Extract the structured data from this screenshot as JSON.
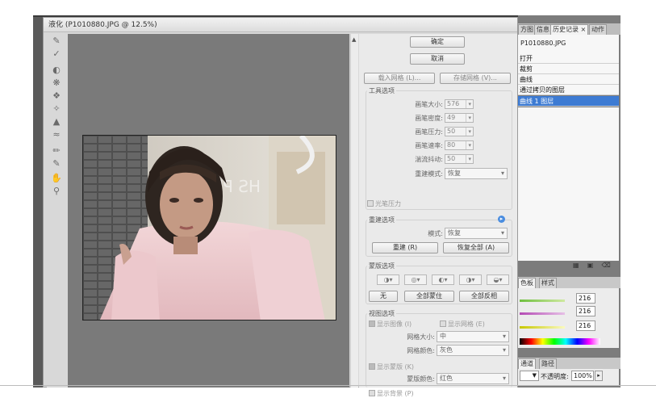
{
  "window": {
    "title": "液化 (P1010880.JPG @ 12.5%)"
  },
  "tools": [
    "forward-warp-icon",
    "reconstruct-icon",
    "twirl-icon",
    "pucker-icon",
    "bloat-icon",
    "push-left-icon",
    "mirror-icon",
    "turbulence-icon",
    "freeze-mask-icon",
    "thaw-mask-icon",
    "hand-icon",
    "zoom-icon"
  ],
  "photo": {
    "sign_text": "HS PLACE"
  },
  "buttons": {
    "ok": "确定",
    "cancel": "取消",
    "load_mesh": "载入网格 (L)...",
    "save_mesh": "存储网格 (V)..."
  },
  "tool_options": {
    "title": "工具选项",
    "brush_size_label": "画笔大小:",
    "brush_size": "576",
    "brush_density_label": "画笔密度:",
    "brush_density": "49",
    "brush_pressure_label": "画笔压力:",
    "brush_pressure": "50",
    "brush_rate_label": "画笔速率:",
    "brush_rate": "80",
    "turbulent_jitter_label": "湍流抖动:",
    "turbulent_jitter": "50",
    "reconstruct_mode_label": "重建模式:",
    "reconstruct_mode": "恢复",
    "stylus_pressure": "光笔压力"
  },
  "reconstruct_options": {
    "title": "重建选项",
    "mode_label": "模式:",
    "mode": "恢复",
    "reconstruct_btn": "重建 (R)",
    "restore_all_btn": "恢复全部 (A)"
  },
  "mask_options": {
    "title": "蒙版选项",
    "none_btn": "无",
    "mask_all_btn": "全部蒙住",
    "invert_all_btn": "全部反相"
  },
  "view_options": {
    "title": "视图选项",
    "show_image": "显示图像 (I)",
    "show_mesh": "显示网格 (E)",
    "mesh_size_label": "网格大小:",
    "mesh_size": "中",
    "mesh_color_label": "网格颜色:",
    "mesh_color": "灰色",
    "show_mask": "显示蒙版 (K)",
    "mask_color_label": "蒙版颜色:",
    "mask_color": "红色",
    "show_backdrop": "显示背景 (P)"
  },
  "right_panel": {
    "tabs": [
      "方图",
      "信息",
      "历史记录 ×",
      "动作"
    ],
    "history_snapshot": "P1010880.JPG",
    "history_items": [
      "打开",
      "裁剪",
      "曲线",
      "通过拷贝的图层",
      "曲线 1 图层"
    ],
    "history_selected_index": 4,
    "color_tabs": [
      "色板",
      "样式"
    ],
    "color_values": [
      "216",
      "216",
      "216"
    ],
    "layers_tabs": [
      "通道",
      "路径"
    ],
    "opacity_label": "不透明度:",
    "opacity": "100%"
  },
  "colors": {
    "selection": "#3d7bd3",
    "panel": "#eaeaea",
    "canvas": "#7a7a7a"
  }
}
